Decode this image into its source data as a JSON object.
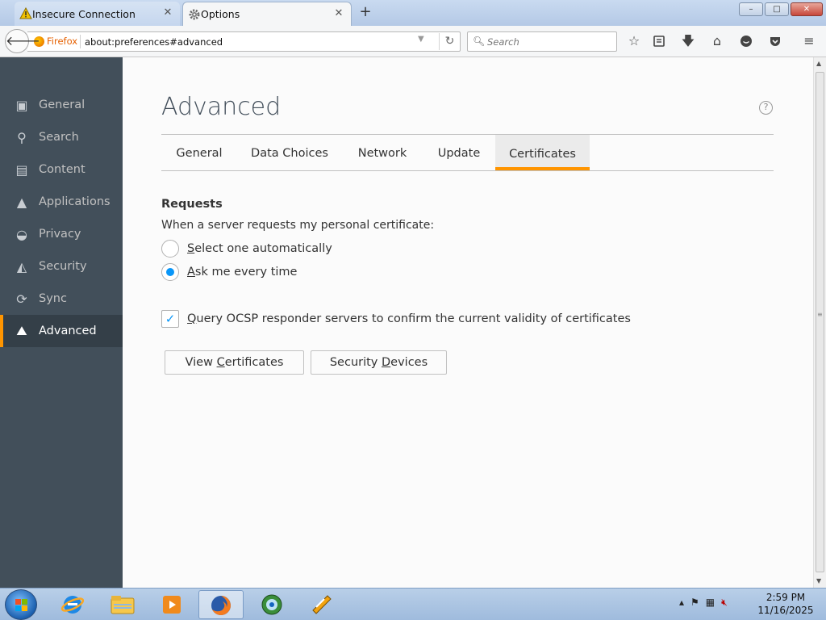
{
  "browser": {
    "tabs": [
      {
        "title": "Insecure Connection",
        "icon": "warning-icon",
        "active": false
      },
      {
        "title": "Options",
        "icon": "gear-icon",
        "active": true
      }
    ],
    "new_tab_label": "+",
    "window_buttons": {
      "minimize": "–",
      "maximize": "□",
      "close": "✕"
    },
    "urlbar": {
      "identity_label": "Firefox",
      "url": "about:preferences#advanced"
    },
    "search": {
      "placeholder": "Search"
    },
    "toolbar_icons": [
      "bookmark-star-icon",
      "reading-list-icon",
      "downloads-icon",
      "home-icon",
      "chat-icon",
      "pocket-icon",
      "menu-icon"
    ]
  },
  "sidebar": {
    "categories": [
      {
        "label": "General",
        "icon": "general-icon"
      },
      {
        "label": "Search",
        "icon": "search-icon"
      },
      {
        "label": "Content",
        "icon": "content-icon"
      },
      {
        "label": "Applications",
        "icon": "applications-icon"
      },
      {
        "label": "Privacy",
        "icon": "privacy-mask-icon"
      },
      {
        "label": "Security",
        "icon": "security-icon"
      },
      {
        "label": "Sync",
        "icon": "sync-icon"
      },
      {
        "label": "Advanced",
        "icon": "advanced-icon",
        "selected": true
      }
    ]
  },
  "main": {
    "title": "Advanced",
    "help": "?",
    "tabs": [
      {
        "label": "General"
      },
      {
        "label": "Data Choices"
      },
      {
        "label": "Network"
      },
      {
        "label": "Update"
      },
      {
        "label": "Certificates",
        "active": true
      }
    ],
    "requests": {
      "heading": "Requests",
      "description": "When a server requests my personal certificate:",
      "options": [
        {
          "label_accel": "S",
          "label_rest": "elect one automatically",
          "selected": false
        },
        {
          "label_accel": "A",
          "label_rest": "sk me every time",
          "selected": true
        }
      ]
    },
    "ocsp": {
      "label_accel": "Q",
      "label_rest": "uery OCSP responder servers to confirm the current validity of certificates",
      "checked": true
    },
    "buttons": {
      "view_certs": {
        "pre": "View ",
        "accel": "C",
        "post": "ertificates"
      },
      "security_devices": {
        "pre": "Security ",
        "accel": "D",
        "post": "evices"
      }
    }
  },
  "taskbar": {
    "apps": [
      "ie-icon",
      "explorer-folder-icon",
      "media-player-icon",
      "firefox-icon",
      "network-globe-icon",
      "winamp-icon"
    ],
    "active_app": "firefox-icon",
    "clock": {
      "time": "2:59 PM",
      "date": "11/16/2025"
    }
  },
  "colors": {
    "accent": "#ff9500",
    "sidebar": "#424f5a",
    "radio_check": "#0996f8"
  }
}
